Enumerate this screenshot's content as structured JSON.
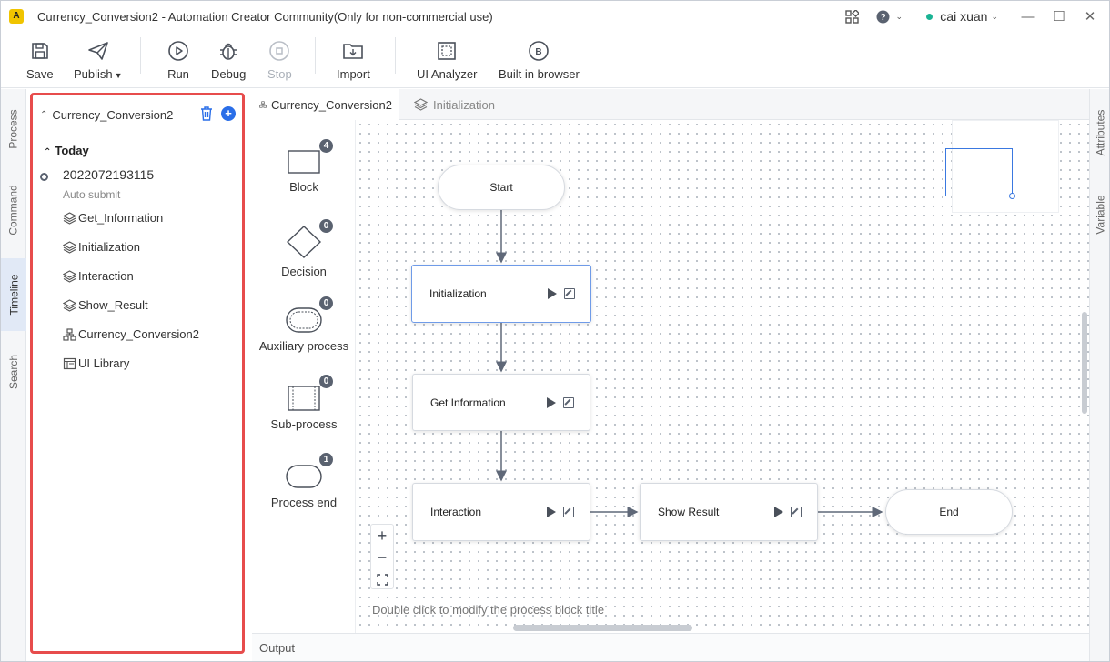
{
  "window": {
    "app_badge": "A",
    "title": "Currency_Conversion2 - Automation Creator Community(Only for non-commercial use)",
    "user": "cai xuan"
  },
  "toolbar": {
    "save": "Save",
    "publish": "Publish",
    "run": "Run",
    "debug": "Debug",
    "stop": "Stop",
    "import": "Import",
    "ui_analyzer": "UI Analyzer",
    "built_in_browser": "Built in browser"
  },
  "left_tabs": [
    "Process",
    "Command",
    "Timeline",
    "Search"
  ],
  "right_tabs": [
    "Attributes",
    "Variable"
  ],
  "timeline": {
    "project": "Currency_Conversion2",
    "group": "Today",
    "snapshot": {
      "id": "2022072193115",
      "note": "Auto submit",
      "files": [
        {
          "label": "Get_Information",
          "icon": "layers-icon"
        },
        {
          "label": "Initialization",
          "icon": "layers-icon"
        },
        {
          "label": "Interaction",
          "icon": "layers-icon"
        },
        {
          "label": "Show_Result",
          "icon": "layers-icon"
        },
        {
          "label": "Currency_Conversion2",
          "icon": "flow-icon"
        },
        {
          "label": "UI Library",
          "icon": "ui-library-icon"
        }
      ]
    }
  },
  "editor_tabs": [
    {
      "label": "Currency_Conversion2",
      "active": true,
      "icon": "flow-icon"
    },
    {
      "label": "Initialization",
      "active": false,
      "icon": "layers-icon"
    }
  ],
  "palette": [
    {
      "label": "Block",
      "count": "4"
    },
    {
      "label": "Decision",
      "count": "0"
    },
    {
      "label": "Auxiliary process",
      "count": "0"
    },
    {
      "label": "Sub-process",
      "count": "0"
    },
    {
      "label": "Process end",
      "count": "1"
    }
  ],
  "flow": {
    "start": "Start",
    "initialization": "Initialization",
    "get_information": "Get Information",
    "interaction": "Interaction",
    "show_result": "Show Result",
    "end": "End"
  },
  "zoom": {
    "in": "+",
    "out": "−"
  },
  "canvas_hint": "Double click to modify the process block title",
  "output": "Output",
  "colors": {
    "accent": "#2a6ee8",
    "highlight_border": "#e74c4c",
    "online": "#1ab394"
  }
}
